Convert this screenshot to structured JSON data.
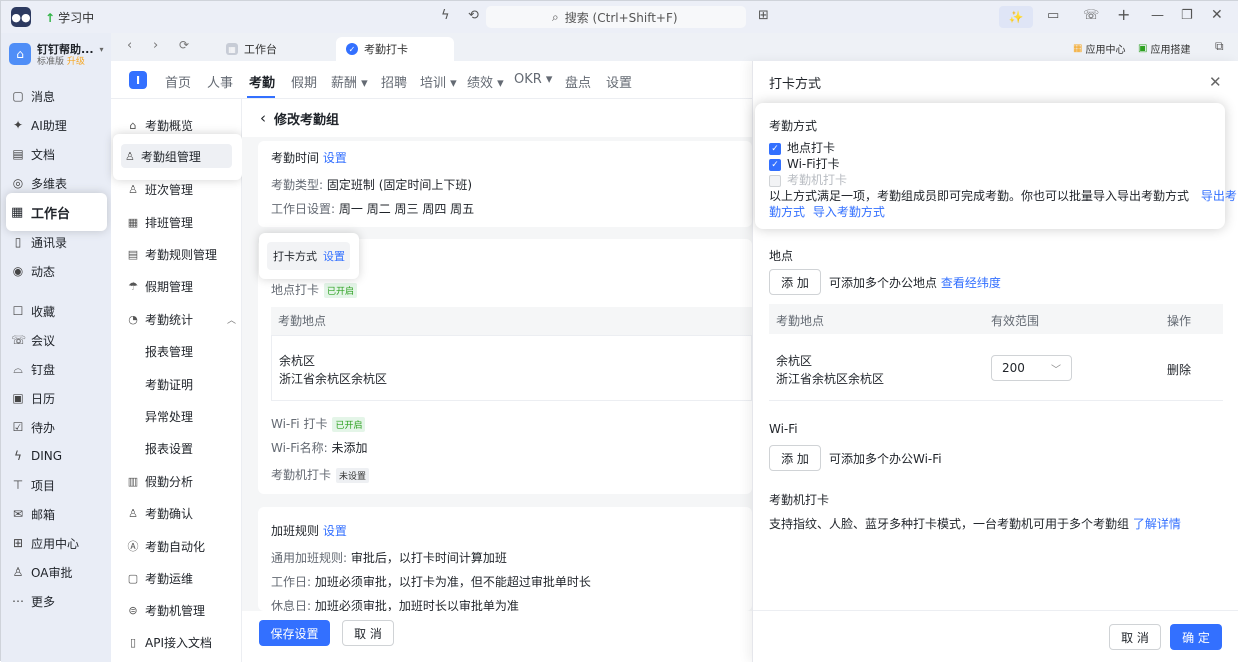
{
  "titlebar": {
    "study_label": "学习中",
    "search_placeholder": "搜索 (Ctrl+Shift+F)",
    "ai_label": "✨"
  },
  "org": {
    "name": "钉钉帮助...",
    "edition": "标准版",
    "upgrade": "升级"
  },
  "nav": {
    "items": [
      {
        "label": "消息",
        "icon": "message-icon"
      },
      {
        "label": "AI助理",
        "icon": "ai-icon"
      },
      {
        "label": "文档",
        "icon": "doc-icon"
      },
      {
        "label": "多维表",
        "icon": "table-icon"
      },
      {
        "label": "工作台",
        "icon": "grid-icon"
      },
      {
        "label": "通讯录",
        "icon": "contacts-icon"
      },
      {
        "label": "动态",
        "icon": "activity-icon"
      },
      {
        "label": "收藏",
        "icon": "favorite-icon"
      },
      {
        "label": "会议",
        "icon": "meeting-icon"
      },
      {
        "label": "钉盘",
        "icon": "drive-icon"
      },
      {
        "label": "日历",
        "icon": "calendar-icon"
      },
      {
        "label": "待办",
        "icon": "todo-icon"
      },
      {
        "label": "DING",
        "icon": "ding-icon"
      },
      {
        "label": "项目",
        "icon": "project-icon"
      },
      {
        "label": "邮箱",
        "icon": "mail-icon"
      },
      {
        "label": "应用中心",
        "icon": "apps-icon"
      },
      {
        "label": "OA审批",
        "icon": "approval-icon"
      },
      {
        "label": "更多",
        "icon": "more-icon"
      }
    ]
  },
  "tabs": [
    {
      "label": "工作台"
    },
    {
      "label": "考勤打卡"
    }
  ],
  "tabs_right": {
    "app_center": "应用中心",
    "app_builder": "应用搭建"
  },
  "topmenu": [
    {
      "label": "首页"
    },
    {
      "label": "人事"
    },
    {
      "label": "考勤"
    },
    {
      "label": "假期"
    },
    {
      "label": "薪酬 ▾"
    },
    {
      "label": "招聘"
    },
    {
      "label": "培训 ▾"
    },
    {
      "label": "绩效 ▾"
    },
    {
      "label": "OKR ▾"
    },
    {
      "label": "盘点"
    },
    {
      "label": "设置"
    }
  ],
  "subnav": {
    "items": [
      {
        "label": "考勤概览"
      },
      {
        "label": "考勤组管理"
      },
      {
        "label": "班次管理"
      },
      {
        "label": "排班管理"
      },
      {
        "label": "考勤规则管理"
      },
      {
        "label": "假期管理"
      },
      {
        "label": "考勤统计"
      },
      {
        "label": "报表管理"
      },
      {
        "label": "考勤证明"
      },
      {
        "label": "异常处理"
      },
      {
        "label": "报表设置"
      },
      {
        "label": "假勤分析"
      },
      {
        "label": "考勤确认"
      },
      {
        "label": "考勤自动化"
      },
      {
        "label": "考勤运维"
      },
      {
        "label": "考勤机管理"
      },
      {
        "label": "API接入文档"
      }
    ]
  },
  "main": {
    "back_title": "修改考勤组",
    "time_section": {
      "title": "考勤时间",
      "set": "设置",
      "type_label": "考勤类型:",
      "type_value": "固定班制 (固定时间上下班)",
      "workday_label": "工作日设置:",
      "workday_value": "周一 周二 周三 周四 周五"
    },
    "punch_section": {
      "title": "打卡方式",
      "set": "设置",
      "location_label": "地点打卡",
      "location_status": "已开启",
      "location_col": "考勤地点",
      "location_name": "余杭区",
      "location_addr": "浙江省余杭区余杭区",
      "wifi_label": "Wi-Fi 打卡",
      "wifi_status": "已开启",
      "wifi_name_label": "Wi-Fi名称:",
      "wifi_name_value": "未添加",
      "machine_label": "考勤机打卡",
      "machine_status": "未设置"
    },
    "overtime_section": {
      "title": "加班规则",
      "set": "设置",
      "general_label": "通用加班规则:",
      "general_value": "审批后，以打卡时间计算加班",
      "workday_label": "工作日:",
      "workday_value": "加班必须审批，以打卡为准，但不能超过审批单时长",
      "restday_label": "休息日:",
      "restday_value": "加班必须审批，加班时长以审批单为准"
    },
    "save_btn": "保存设置",
    "cancel_btn": "取 消"
  },
  "drawer": {
    "title": "打卡方式",
    "method_title": "考勤方式",
    "opt_location": "地点打卡",
    "opt_wifi": "Wi-Fi打卡",
    "opt_machine": "考勤机打卡",
    "hint": "以上方式满足一项，考勤组成员即可完成考勤。你也可以批量导入导出考勤方式",
    "export_link_1": "导出考",
    "export_link_2": "勤方式",
    "import_link": "导入考勤方式",
    "location_title": "地点",
    "add_btn": "添 加",
    "location_hint": "可添加多个办公地点",
    "lnglat_link": "查看经纬度",
    "th_location": "考勤地点",
    "th_range": "有效范围",
    "th_action": "操作",
    "row_name": "余杭区",
    "row_addr": "浙江省余杭区余杭区",
    "row_range": "200",
    "row_delete": "删除",
    "wifi_title": "Wi-Fi",
    "wifi_add_btn": "添 加",
    "wifi_hint": "可添加多个办公Wi-Fi",
    "machine_title": "考勤机打卡",
    "machine_hint": "支持指纹、人脸、蓝牙多种打卡模式，一台考勤机可用于多个考勤组",
    "machine_link": "了解详情",
    "cancel_btn": "取 消",
    "ok_btn": "确 定"
  }
}
